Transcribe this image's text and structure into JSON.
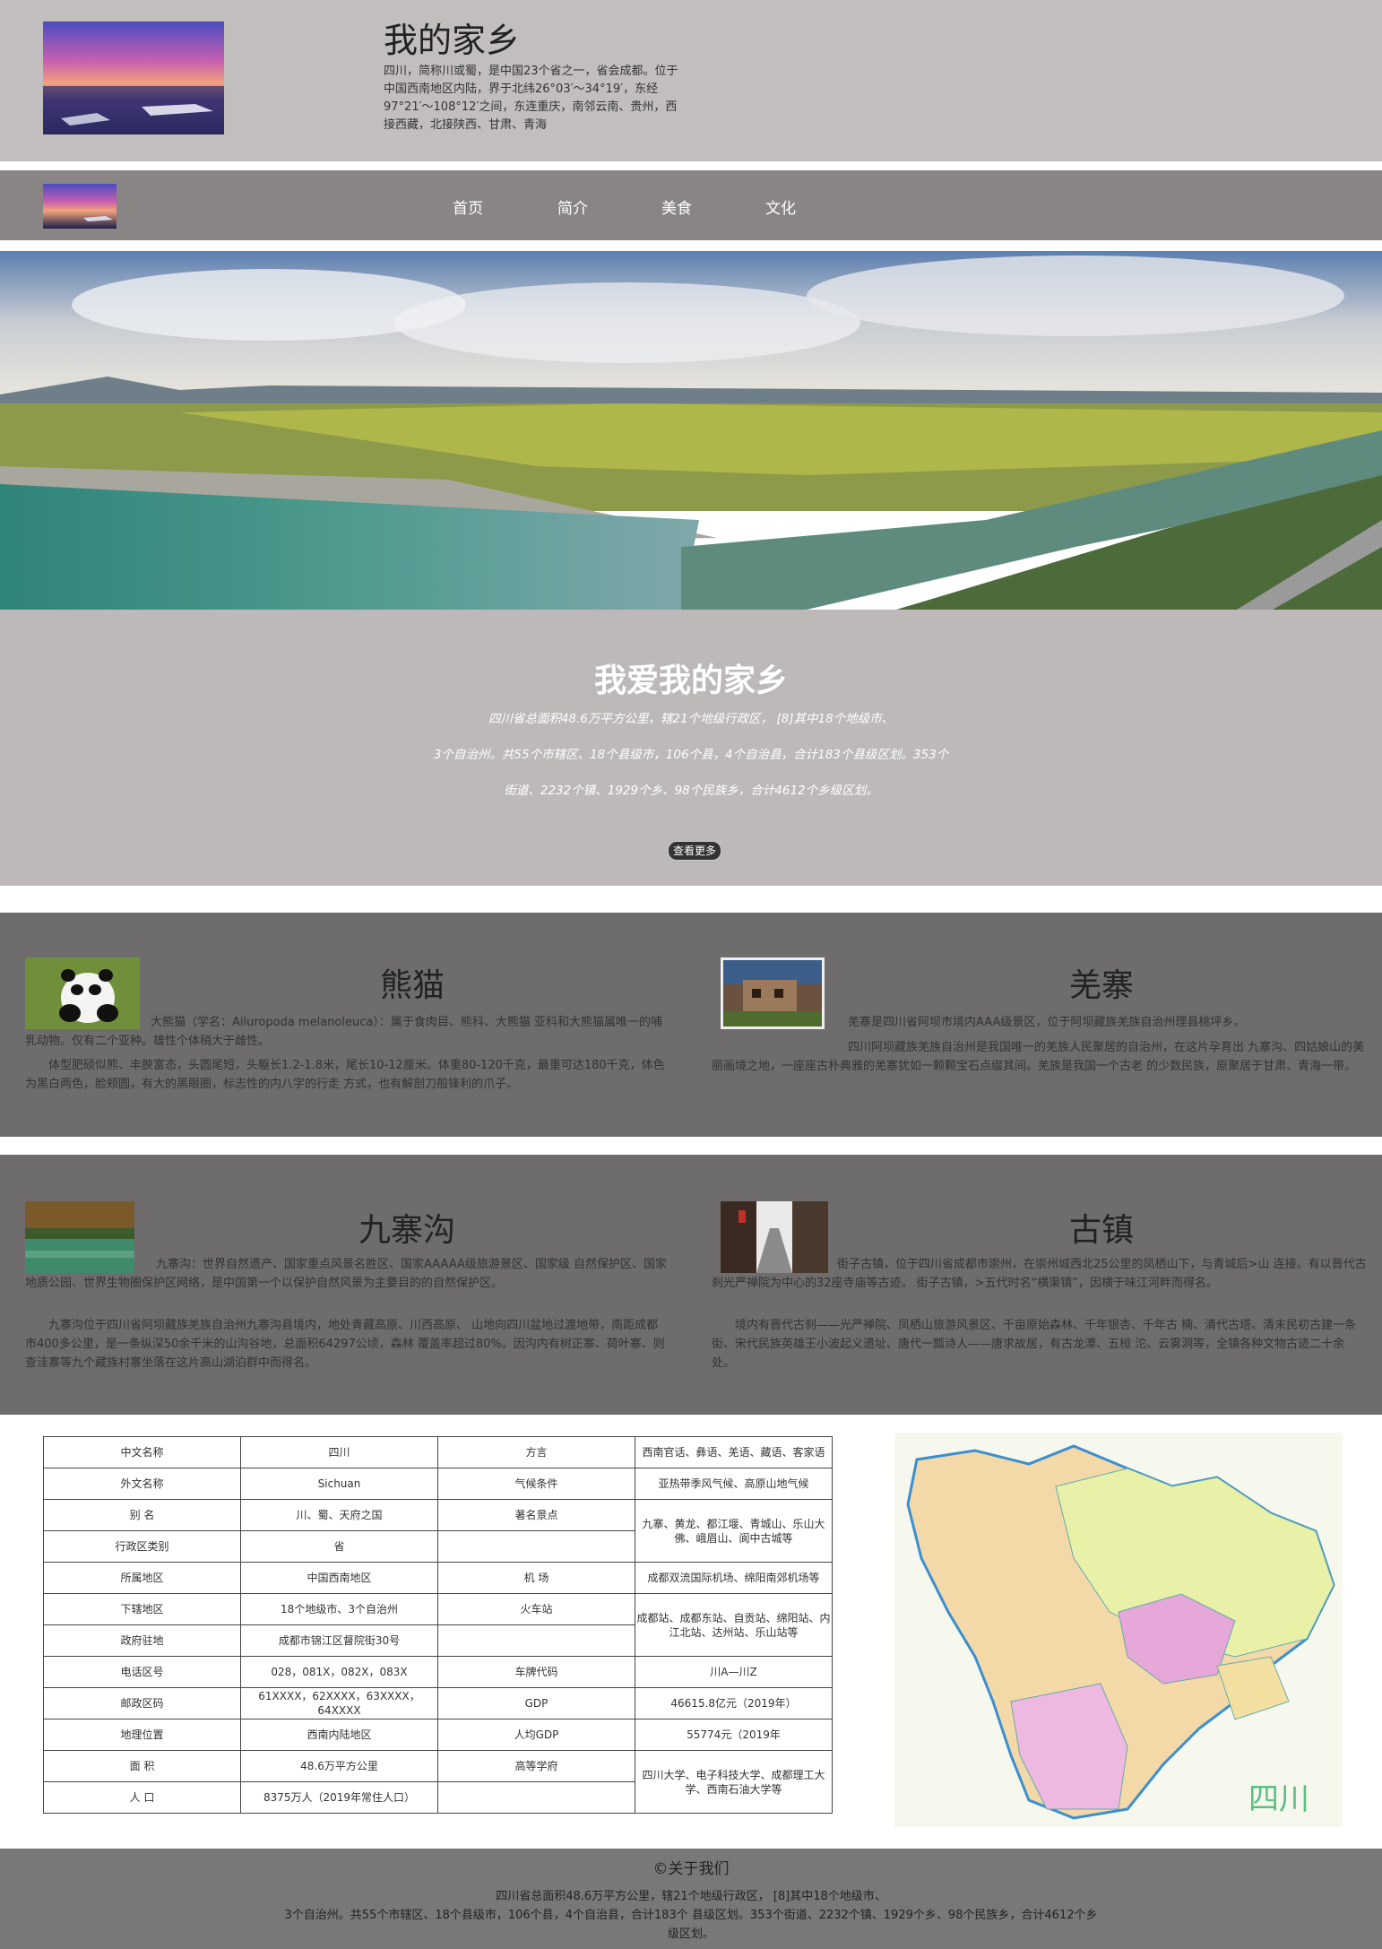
{
  "header": {
    "title": "我的家乡",
    "intro": "四川，简称川或蜀，是中国23个省之一，省会成都。位于中国西南地区内陆，界于北纬26°03′～34°19′，东经97°21′～108°12′之间，东连重庆，南邻云南、贵州，西接西藏，北接陕西、甘肃、青海"
  },
  "nav": {
    "items": [
      "首页",
      "简介",
      "美食",
      "文化"
    ]
  },
  "love": {
    "title": "我爱我的家乡",
    "line1": "四川省总面积48.6万平方公里，辖21个地级行政区， [8]其中18个地级市、",
    "line2": "3个自治州。共55个市辖区、18个县级市，106个县，4个自治县，合计183个县级区划。353个",
    "line3": "街道、2232个镇、1929个乡、98个民族乡，合计4612个乡级区划。",
    "button": "查看更多"
  },
  "cards": {
    "panda": {
      "title": "熊猫",
      "p1": "大熊猫（学名：Ailuropoda melanoleuca）：属于食肉目、熊科、大熊猫 亚科和大熊猫属唯一的哺乳动物。仅有二个亚种。雄性个体稍大于雌性。",
      "p2": "体型肥硕似熊、丰腴富态，头圆尾短，头躯长1.2-1.8米，尾长10-12厘米。体重80-120千克，最重可达180千克，体色为黑白两色，脸颊圆，有大的黑眼圈，标志性的内八字的行走 方式，也有解剖刀般锋利的爪子。"
    },
    "qiang": {
      "title": "羌寨",
      "p1": "羌寨是四川省阿坝市境内AAA级景区，位于阿坝藏族羌族自治州理县桃坪乡。",
      "p2": "四川阿坝藏族羌族自治州是我国唯一的羌族人民聚居的自治州，在这片孕育出 九寨沟、四姑娘山的美丽画境之地，一座座古朴典雅的羌寨犹如一颗颗宝石点缀其间。羌族是我国一个古老 的少数民族，原聚居于甘肃、青海一带。"
    },
    "jiuzhai": {
      "title": "九寨沟",
      "p1": "九寨沟：世界自然遗产、国家重点风景名胜区、国家AAAAA级旅游景区、国家级 自然保护区、国家地质公园、世界生物圈保护区网络，是中国第一个以保护自然风景为主要目的的自然保护区。",
      "p2": "九寨沟位于四川省阿坝藏族羌族自治州九寨沟县境内，地处青藏高原、川西高原、 山地向四川盆地过渡地带，南距成都市400多公里，是一条纵深50余千米的山沟谷地，总面积64297公顷，森林 覆盖率超过80%。因沟内有树正寨、荷叶寨、则查洼寨等九个藏族村寨坐落在这片高山湖泊群中而得名。"
    },
    "guzhen": {
      "title": "古镇",
      "p1": "街子古镇，位于四川省成都市崇州，在崇州城西北25公里的凤栖山下，与青城后>山 连接。有以晋代古刹光严禅院为中心的32座寺庙等古迹。 街子古镇，>五代时名“横渠镇”，因横于味江河畔而得名。",
      "p2": "境内有晋代古刹——光严禅院、凤栖山旅游风景区、千亩原始森林、千年银杏、千年古 楠、清代古塔、清末民初古建一条街、宋代民族英雄王小波起义遗址、唐代一瓢诗人——唐求故居，有古龙潭、五桓 沱、云雾洞等，全镇各种文物古迹二十余处。"
    }
  },
  "table": {
    "left": [
      [
        "中文名称",
        "四川"
      ],
      [
        "外文名称",
        "Sichuan"
      ],
      [
        "别 名",
        "川、蜀、天府之国"
      ],
      [
        "行政区类别",
        "省"
      ],
      [
        "所属地区",
        "中国西南地区"
      ],
      [
        "下辖地区",
        "18个地级市、3个自治州"
      ],
      [
        "政府驻地",
        "成都市锦江区督院街30号"
      ],
      [
        "电话区号",
        "028，081X，082X，083X"
      ],
      [
        "邮政区码",
        "61XXXX，62XXXX，63XXXX，64XXXX"
      ],
      [
        "地理位置",
        "西南内陆地区"
      ],
      [
        "面 积",
        "48.6万平方公里"
      ],
      [
        "人 口",
        "8375万人（2019年常住人口）"
      ]
    ],
    "right": {
      "dialect_label": "方言",
      "dialect": "西南官话、彝语、羌语、藏语、客家语",
      "climate_label": "气候条件",
      "climate": "亚热带季风气候、高原山地气候",
      "scenic_label": "著名景点",
      "scenic": "九寨、黄龙、都江堰、青城山、乐山大佛、峨眉山、阆中古城等",
      "airport_label": "机 场",
      "airport": "成都双流国际机场、绵阳南郊机场等",
      "station_label": "火车站",
      "station": "成都站、成都东站、自贡站、绵阳站、内江北站、达州站、乐山站等",
      "plate_label": "车牌代码",
      "plate": "川A—川Z",
      "gdp_label": "GDP",
      "gdp": "46615.8亿元（2019年）",
      "pgdp_label": "人均GDP",
      "pgdp": "55774元（2019年",
      "univ_label": "高等学府",
      "univ": "四川大学、电子科技大学、成都理工大学、西南石油大学等"
    }
  },
  "map": {
    "label": "四川"
  },
  "footer": {
    "title": "©关于我们",
    "line1": "四川省总面积48.6万平方公里，辖21个地级行政区， [8]其中18个地级市、",
    "line2": "3个自治州。共55个市辖区、18个县级市，106个县，4个自治县，合计183个 县级区划。353个街道、2232个镇、1929个乡、98个民族乡，合计4612个乡",
    "line3": "级区划。"
  }
}
